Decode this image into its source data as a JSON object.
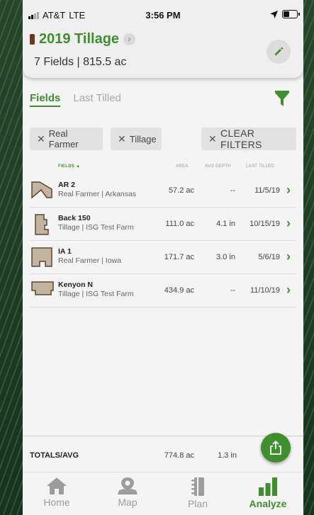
{
  "status": {
    "carrier": "AT&T",
    "network": "LTE",
    "time": "3:56 PM"
  },
  "plan": {
    "title": "2019 Tillage",
    "chip_color": "#6b3a1e",
    "summary": "7 Fields | 815.5 ac"
  },
  "tabs": [
    {
      "label": "Fields",
      "active": true
    },
    {
      "label": "Last Tilled",
      "active": false
    }
  ],
  "filters": {
    "chips": [
      {
        "label": "Real Farmer"
      },
      {
        "label": "Tillage"
      }
    ],
    "clear_label": "CLEAR FILTERS"
  },
  "table": {
    "headers": {
      "fields": "FIELDS ▲",
      "area": "AREA",
      "depth": "AVG DEPTH",
      "tilled": "LAST TILLED"
    },
    "rows": [
      {
        "name": "AR 2",
        "sub": "Real Farmer | Arkansas",
        "area": "57.2 ac",
        "depth": "--",
        "tilled": "11/5/19"
      },
      {
        "name": "Back 150",
        "sub": "Tillage | ISG Test Farm",
        "area": "111.0 ac",
        "depth": "4.1 in",
        "tilled": "10/15/19"
      },
      {
        "name": "IA 1",
        "sub": "Real Farmer | Iowa",
        "area": "171.7 ac",
        "depth": "3.0 in",
        "tilled": "5/6/19"
      },
      {
        "name": "Kenyon N",
        "sub": "Tillage | ISG Test Farm",
        "area": "434.9 ac",
        "depth": "--",
        "tilled": "11/10/19"
      }
    ]
  },
  "totals": {
    "label": "TOTALS/AVG",
    "area": "774.8 ac",
    "depth": "1.3 in"
  },
  "nav": [
    {
      "label": "Home",
      "icon": "home-icon",
      "active": false
    },
    {
      "label": "Map",
      "icon": "map-pin-icon",
      "active": false
    },
    {
      "label": "Plan",
      "icon": "notebook-icon",
      "active": false
    },
    {
      "label": "Analyze",
      "icon": "bar-chart-icon",
      "active": true
    }
  ],
  "colors": {
    "accent": "#3f8f2e",
    "field_fill": "#c4b49f",
    "field_stroke": "#5a4634"
  }
}
